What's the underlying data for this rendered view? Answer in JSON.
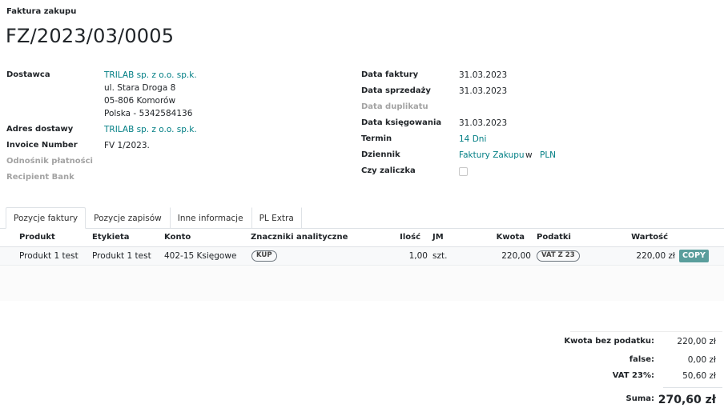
{
  "header": {
    "doc_type": "Faktura zakupu",
    "doc_number": "FZ/2023/03/0005"
  },
  "left_fields": {
    "supplier_label": "Dostawca",
    "supplier_name": "TRILAB sp. z o.o. sp.k.",
    "supplier_address_1": "ul. Stara Droga 8",
    "supplier_address_2": "05-806 Komorów",
    "supplier_address_3": "Polska - 5342584136",
    "delivery_label": "Adres dostawy",
    "delivery_value": "TRILAB sp. z o.o. sp.k.",
    "invoice_number_label": "Invoice Number",
    "invoice_number_value": "FV 1/2023.",
    "payment_ref_label": "Odnośnik płatności",
    "recipient_bank_label": "Recipient Bank"
  },
  "right_fields": {
    "invoice_date_label": "Data faktury",
    "invoice_date_value": "31.03.2023",
    "sale_date_label": "Data sprzedaży",
    "sale_date_value": "31.03.2023",
    "duplicate_date_label": "Data duplikatu",
    "accounting_date_label": "Data księgowania",
    "accounting_date_value": "31.03.2023",
    "term_label": "Termin",
    "term_value": "14 Dni",
    "journal_label": "Dziennik",
    "journal_value": "Faktury Zakupu",
    "journal_in": "w",
    "currency_value": "PLN",
    "advance_label": "Czy zaliczka"
  },
  "tabs": [
    "Pozycje faktury",
    "Pozycje zapisów",
    "Inne informacje",
    "PL Extra"
  ],
  "table": {
    "headers": {
      "product": "Produkt",
      "label": "Etykieta",
      "account": "Konto",
      "analytic": "Znaczniki analityczne",
      "qty": "Ilość",
      "uom": "JM",
      "price": "Kwota",
      "taxes": "Podatki",
      "subtotal": "Wartość"
    },
    "rows": [
      {
        "product": "Produkt 1 test",
        "label": "Produkt 1 test",
        "account": "402-15 Księgowe",
        "analytic": "KUP",
        "qty": "1,00",
        "uom": "szt.",
        "price": "220,00",
        "taxes": "VAT Z 23",
        "subtotal": "220,00 zł",
        "action": "COPY"
      }
    ]
  },
  "totals": {
    "untaxed_label": "Kwota bez podatku:",
    "untaxed_value": "220,00 zł",
    "false_label": "false:",
    "false_value": "0,00 zł",
    "vat_label": "VAT 23%:",
    "vat_value": "50,60 zł",
    "sum_label": "Suma:",
    "sum_value": "270,60 zł"
  },
  "colors": {
    "link": "#017e84",
    "copy_button": "#5a9e9c",
    "muted_label": "#a3a3a3"
  }
}
